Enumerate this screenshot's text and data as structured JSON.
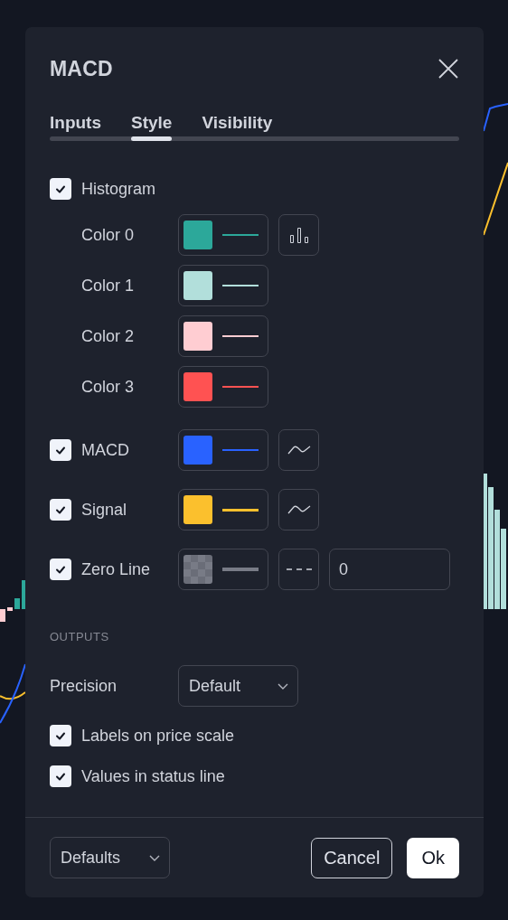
{
  "dialog": {
    "title": "MACD",
    "tabs": [
      {
        "label": "Inputs",
        "selected": false
      },
      {
        "label": "Style",
        "selected": true
      },
      {
        "label": "Visibility",
        "selected": false
      }
    ],
    "histogram": {
      "label": "Histogram",
      "checked": true
    },
    "histogram_colors": [
      {
        "label": "Color 0",
        "color": "#2ca89a",
        "kind": "columns"
      },
      {
        "label": "Color 1",
        "color": "#b2dfdb",
        "kind": "plain"
      },
      {
        "label": "Color 2",
        "color": "#ffcdd2",
        "kind": "plain"
      },
      {
        "label": "Color 3",
        "color": "#ff5252",
        "kind": "plain"
      }
    ],
    "plots": [
      {
        "label": "MACD",
        "checked": true,
        "color": "#2962ff",
        "checkered": false,
        "kind": "line"
      },
      {
        "label": "Signal",
        "checked": true,
        "color": "#fbc02d",
        "checkered": false,
        "kind": "line"
      },
      {
        "label": "Zero Line",
        "checked": true,
        "color": "#787b86",
        "checkered": true,
        "kind": "dashed",
        "value": "0"
      }
    ],
    "outputs": {
      "heading": "OUTPUTS",
      "precision": {
        "label": "Precision",
        "value": "Default"
      },
      "options": [
        {
          "label": "Labels on price scale",
          "checked": true
        },
        {
          "label": "Values in status line",
          "checked": true
        }
      ]
    },
    "footer": {
      "template": "Defaults",
      "cancel": "Cancel",
      "ok": "Ok"
    }
  }
}
